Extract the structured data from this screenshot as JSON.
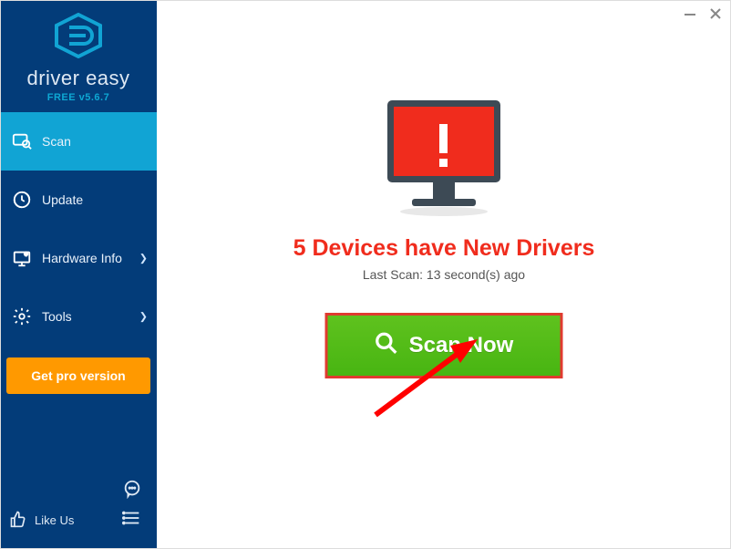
{
  "app": {
    "brand": "driver easy",
    "version_label": "FREE v5.6.7"
  },
  "sidebar": {
    "items": [
      {
        "label": "Scan"
      },
      {
        "label": "Update"
      },
      {
        "label": "Hardware Info"
      },
      {
        "label": "Tools"
      }
    ],
    "pro_button": "Get pro version",
    "like_us": "Like Us"
  },
  "main": {
    "headline": "5 Devices have New Drivers",
    "last_scan": "Last Scan: 13 second(s) ago",
    "scan_button": "Scan Now"
  },
  "colors": {
    "sidebar_bg": "#033c79",
    "accent": "#11a4d4",
    "pro": "#ff9900",
    "alert_red": "#f02c1d",
    "scan_green": "#4fb917"
  }
}
